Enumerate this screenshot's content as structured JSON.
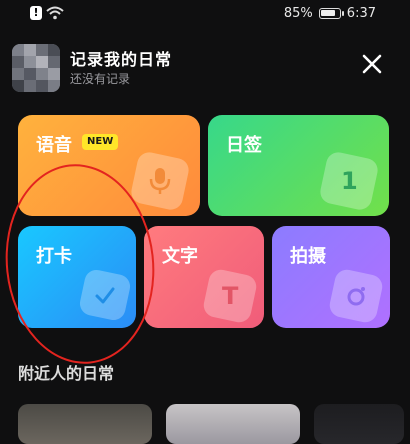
{
  "status_bar": {
    "battery_percent": "85%",
    "battery_level": 0.85,
    "time": "6:37"
  },
  "header": {
    "title": "记录我的日常",
    "subtitle": "还没有记录"
  },
  "cards": {
    "voice": {
      "label": "语音",
      "badge": "NEW",
      "icon": "microphone-icon"
    },
    "signature": {
      "label": "日签",
      "icon_text": "1"
    },
    "checkin": {
      "label": "打卡",
      "icon": "checkmark-icon"
    },
    "text": {
      "label": "文字",
      "icon_text": "T"
    },
    "photo": {
      "label": "拍摄",
      "icon": "camera-icon"
    }
  },
  "nearby": {
    "title": "附近人的日常"
  },
  "colors": {
    "background": "#0f0f10",
    "voice": "#ff9b3c",
    "signature": "#4bdc78",
    "checkin": "#1cb5ff",
    "text": "#f96b7c",
    "photo": "#9e76ff",
    "annotation": "#e3241f"
  }
}
